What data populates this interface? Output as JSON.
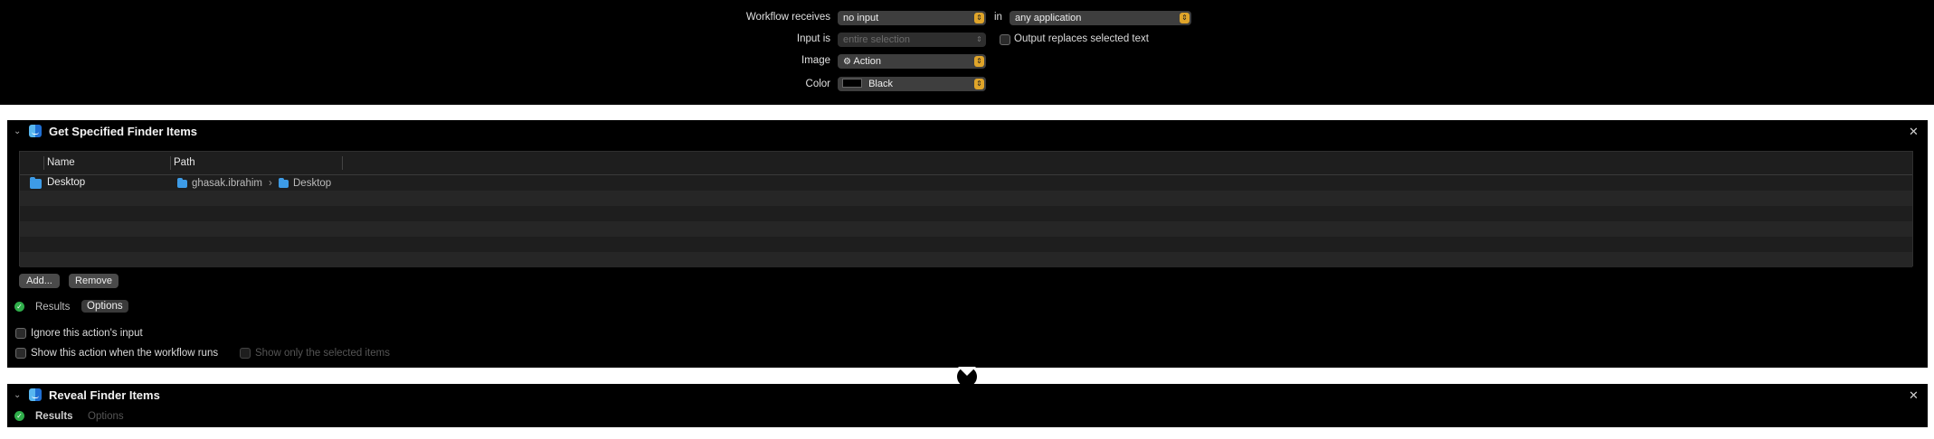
{
  "header": {
    "workflow_receives_label": "Workflow receives",
    "workflow_receives_value": "no input",
    "in_label": "in",
    "application_value": "any application",
    "input_is_label": "Input is",
    "input_is_value": "entire selection",
    "output_replaces_label": "Output replaces selected text",
    "image_label": "Image",
    "image_value": "Action",
    "image_glyph": "⚙",
    "color_label": "Color",
    "color_value": "Black",
    "color_swatch": "#000000",
    "accent_color": "#e0a52a"
  },
  "action1": {
    "title": "Get Specified Finder Items",
    "columns": [
      "Name",
      "Path"
    ],
    "rows": [
      {
        "name": "Desktop",
        "path_parts": [
          "ghasak.ibrahim",
          "Desktop"
        ],
        "separator": "›"
      }
    ],
    "add_label": "Add...",
    "remove_label": "Remove",
    "tab_results": "Results",
    "tab_options": "Options",
    "ignore_input_label": "Ignore this action's input",
    "show_action_label": "Show this action when the workflow runs",
    "show_selected_label": "Show only the selected items"
  },
  "action2": {
    "title": "Reveal Finder Items",
    "tab_results": "Results",
    "tab_options": "Options"
  },
  "icons": {
    "close": "✕",
    "chevron": "⌄",
    "popup_arrows": "⇕",
    "check": "✓"
  }
}
